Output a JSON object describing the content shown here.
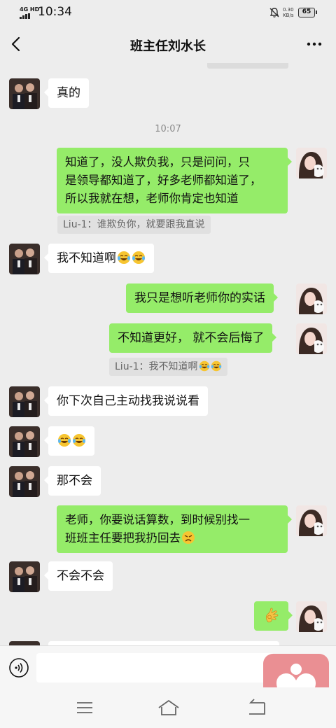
{
  "status_bar": {
    "network": "4G HD",
    "time": "10:34",
    "speed_value": "0.30",
    "speed_unit": "KB/s",
    "battery": "65"
  },
  "header": {
    "title": "班主任刘水长"
  },
  "messages": [
    {
      "side": "left",
      "text": "真的"
    },
    {
      "timestamp": "10:07"
    },
    {
      "side": "right",
      "lines": [
        "知道了，没人欺负我，只是问问，只",
        "是领导都知道了，好多老师都知道了，",
        "所以我就在想，老师你肯定也知道"
      ]
    },
    {
      "quote": "Liu-1：谁欺负你，就要跟我直说"
    },
    {
      "side": "left",
      "text": "我不知道啊",
      "emoji": [
        "laugh-cry-emoji",
        "laugh-cry-emoji"
      ]
    },
    {
      "side": "right",
      "text": "我只是想听老师你的实话"
    },
    {
      "side": "right",
      "text": "不知道更好，  就不会后悔了"
    },
    {
      "quote": "Liu-1：我不知道啊",
      "emoji": [
        "laugh-cry-emoji",
        "laugh-cry-emoji"
      ]
    },
    {
      "side": "left",
      "text": "你下次自己主动找我说说看"
    },
    {
      "side": "left",
      "emoji": [
        "laugh-cry-emoji",
        "laugh-cry-emoji"
      ]
    },
    {
      "side": "left",
      "text": "那不会"
    },
    {
      "side": "right",
      "lines": [
        "老师，你要说话算数，到时候别找一",
        "班班主任要把我扔回去"
      ],
      "emoji": [
        "angry-emoji"
      ]
    },
    {
      "side": "left",
      "text": "不会不会"
    },
    {
      "side": "right",
      "emoji": [
        "ok-hand-emoji"
      ]
    }
  ],
  "icons": {
    "back": "chevron-left-icon",
    "more": "more-dots-icon",
    "voice": "voice-icon",
    "float": "heart-person-icon",
    "nav": [
      "menu-icon",
      "home-icon",
      "back-arrow-icon"
    ]
  },
  "colors": {
    "background": "#ededed",
    "bubble_right": "#95ec69",
    "bubble_left": "#ffffff",
    "float_button": "#ea8f93"
  }
}
